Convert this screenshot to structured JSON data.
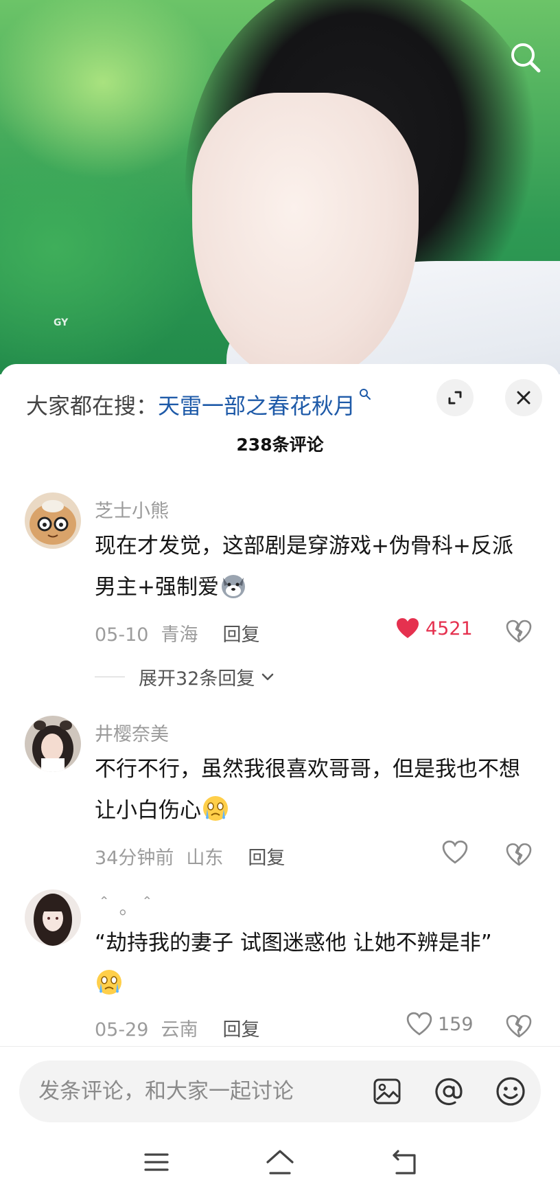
{
  "video": {
    "watermark": "GY"
  },
  "panel": {
    "trending_prefix": "大家都在搜：",
    "trending_query": "天雷一部之春花秋月",
    "comment_count": "238条评论"
  },
  "comments": [
    {
      "username": "芝士小熊",
      "text": "现在才发觉，这部剧是穿游戏+伪骨科+反派男主+强制爱",
      "date": "05-10",
      "location": "青海",
      "reply_label": "回复",
      "likes": "4521",
      "liked": true,
      "expand_label": "展开32条回复"
    },
    {
      "username": "井樱奈美",
      "text": "不行不行，虽然我很喜欢哥哥，但是我也不想让小白伤心",
      "date": "34分钟前",
      "location": "山东",
      "reply_label": "回复",
      "likes": "",
      "liked": false
    },
    {
      "username": "＾ 。＾",
      "text": "“劫持我的妻子 试图迷惑他 让她不辨是非”",
      "date": "05-29",
      "location": "云南",
      "reply_label": "回复",
      "likes": "159",
      "liked": false
    }
  ],
  "input": {
    "placeholder": "发条评论，和大家一起讨论"
  },
  "colors": {
    "link": "#1e5aa8",
    "like_active": "#e5314f",
    "meta": "#9c9c9c"
  }
}
